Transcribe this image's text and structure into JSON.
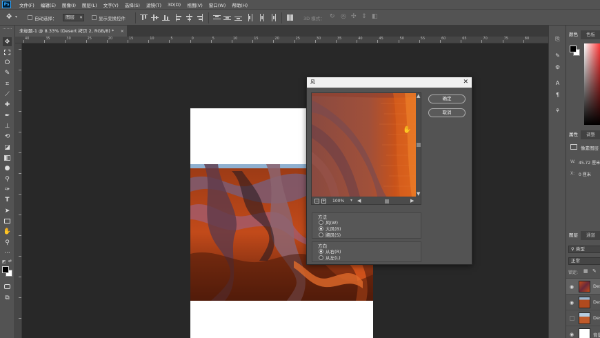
{
  "menubar": {
    "logo": "Ps",
    "items": [
      "文件(F)",
      "编辑(E)",
      "图像(I)",
      "图层(L)",
      "文字(Y)",
      "选择(S)",
      "滤镜(T)",
      "3D(D)",
      "视图(V)",
      "窗口(W)",
      "帮助(H)"
    ]
  },
  "options": {
    "auto_select_label": "自动选择：",
    "auto_select_value": "图层",
    "show_transform_label": "显示变换控件",
    "mode_3d_label": "3D 模式："
  },
  "document": {
    "tab_title": "未标题-1 @ 8.33% (Desert 拷贝 2, RGB/8) *",
    "tab_close": "×"
  },
  "ruler": {
    "h_labels": [
      "40",
      "35",
      "30",
      "25",
      "20",
      "15",
      "10",
      "5",
      "0",
      "5",
      "10",
      "15",
      "20",
      "25",
      "30",
      "35",
      "40",
      "45",
      "50",
      "55",
      "60",
      "65",
      "70",
      "75",
      "80"
    ]
  },
  "dialog": {
    "title": "风",
    "close": "✕",
    "ok": "确定",
    "cancel": "取消",
    "zoom": "100%",
    "method_title": "方法",
    "method_options": [
      "风(W)",
      "大风(B)",
      "飓风(S)"
    ],
    "method_selected": 1,
    "direction_title": "方向",
    "direction_options": [
      "从右(R)",
      "从左(L)"
    ],
    "direction_selected": 0
  },
  "panels": {
    "color_tab": "颜色",
    "swatches_tab": "色板",
    "properties_tab": "属性",
    "adjustments_tab": "调整",
    "pixel_layer_label": "像素图层",
    "w_label": "W:",
    "w_value": "45.72 厘米",
    "x_label": "X:",
    "x_value": "0 厘米",
    "layers_tab": "图层",
    "channels_tab": "通道",
    "kind_filter": "类型",
    "blend_mode": "正常",
    "lock_label": "锁定:",
    "layers": [
      {
        "name": "Des",
        "visible": true
      },
      {
        "name": "Des",
        "visible": true
      },
      {
        "name": "Des",
        "visible": false
      },
      {
        "name": "背景",
        "visible": true
      }
    ]
  },
  "colors": {
    "ui_dark": "#535353",
    "canvas_bg": "#282828",
    "desert_orange": "#c2461b"
  }
}
